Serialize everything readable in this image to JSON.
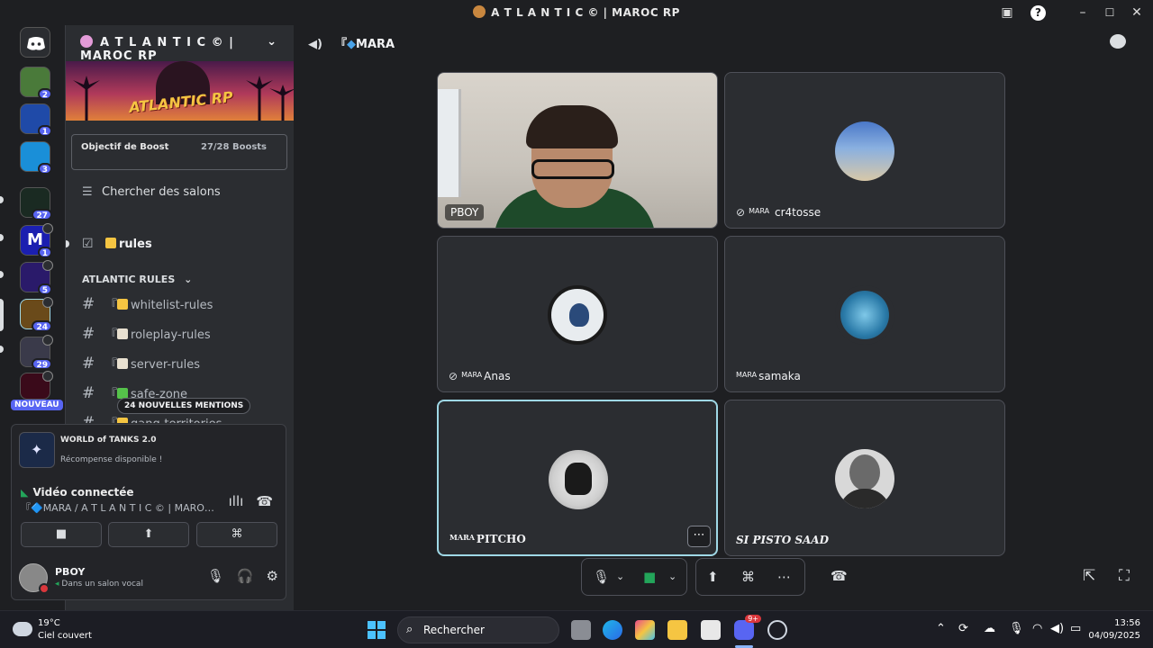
{
  "window": {
    "title": "A T L A N T I C © | MAROC RP"
  },
  "rail": {
    "badges": [
      "2",
      "1",
      "3",
      "27",
      "1",
      "5",
      "24",
      "29"
    ],
    "new_label": "NOUVEAU"
  },
  "sidebar": {
    "guild_name": "A T L A N T I C © | MAROC RP",
    "banner_text": "ATLANTIC RP",
    "boost_title": "Objectif de Boost",
    "boost_count": "27/28 Boosts",
    "search_channels": "Chercher des salons",
    "channels": [
      {
        "name": "rules",
        "prefix": "",
        "emoji_color": "#f5c542",
        "active": true
      },
      {
        "name": "whitelist-rules",
        "prefix": "『",
        "emoji_color": "#f5c542"
      },
      {
        "name": "roleplay-rules",
        "prefix": "『",
        "emoji_color": "#e8e0d0"
      },
      {
        "name": "server-rules",
        "prefix": "『",
        "emoji_color": "#e8e0d0"
      },
      {
        "name": "safe-zone",
        "prefix": "『",
        "emoji_color": "#55c24a"
      },
      {
        "name": "gang-territories",
        "prefix": "『",
        "emoji_color": "#f5c542"
      }
    ],
    "category": "ATLANTIC RULES",
    "mentions_pill": "24 NOUVELLES MENTIONS"
  },
  "panel": {
    "promo_name": "WORLD of TANKS 2.0",
    "promo_sub": "Récompense disponible !",
    "voice_status": "Vidéo connectée",
    "voice_channel": "『🔷MARA / A T L A N T I C © | MAROC ...",
    "user_name": "PBOY",
    "user_status": "Dans un salon vocal"
  },
  "main": {
    "channel_prefix": "『",
    "channel_name": "MARA",
    "tiles": [
      {
        "name": "PBOY",
        "tag": "",
        "muted": false
      },
      {
        "name": "cr4tosse",
        "tag": "MARA",
        "muted": true
      },
      {
        "name": "Anas",
        "tag": "MARA",
        "muted": true
      },
      {
        "name": "samaka",
        "tag": "MARA",
        "muted": false
      },
      {
        "name": "PITCHO",
        "tag": "MARA",
        "muted": false
      },
      {
        "name": "SI PISTO SAAD",
        "tag": "",
        "muted": false
      }
    ]
  },
  "taskbar": {
    "temperature": "19°C",
    "weather": "Ciel couvert",
    "search": "Rechercher",
    "discord_badge": "9+",
    "time": "13:56",
    "date": "04/09/2025"
  },
  "colors": {
    "accent": "#5865f2",
    "speaking": "#9fd8e6",
    "connected": "#23a55a",
    "hangup": "#da373c"
  }
}
